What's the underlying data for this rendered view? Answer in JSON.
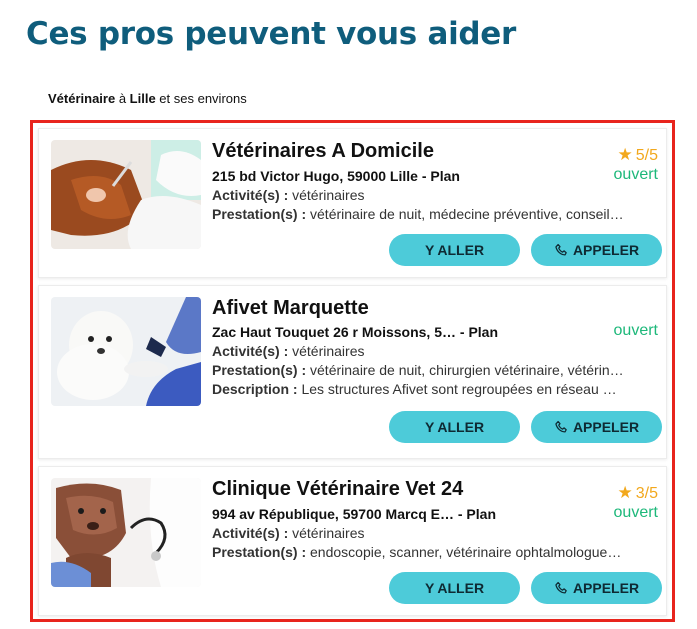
{
  "page": {
    "title": "Ces pros peuvent vous aider",
    "context": {
      "category": "Vétérinaire",
      "sep": " à ",
      "city": "Lille",
      "suffix": " et ses environs"
    }
  },
  "colors": {
    "title": "#0f5d7c",
    "frame": "#e8241d",
    "button": "#4dcbd9",
    "open": "#1db87a",
    "star": "#f2a81d"
  },
  "labels": {
    "activity": "Activité(s) :",
    "services": "Prestation(s) :",
    "description": "Description :",
    "goto_button": "Y ALLER",
    "call_button": "APPELER"
  },
  "results": [
    {
      "name": "Vétérinaires A Domicile",
      "address": "215 bd Victor Hugo, 59000 Lille - Plan",
      "rating": "5/5",
      "status": "ouvert",
      "activity": "vétérinaires",
      "services": "vétérinaire de nuit, médecine préventive, conseil…",
      "image_icon": "dog-ear-exam-photo"
    },
    {
      "name": "Afivet Marquette",
      "address": "Zac Haut Touquet 26 r Moissons, 5…   - Plan",
      "status": "ouvert",
      "activity": "vétérinaires",
      "services": "vétérinaire de nuit, chirurgien vétérinaire, vétérin…",
      "description": "Les structures Afivet sont regroupées en réseau …",
      "image_icon": "white-dog-paw-bandage-photo"
    },
    {
      "name": "Clinique Vétérinaire Vet 24",
      "address": "994 av République, 59700 Marcq E…   - Plan",
      "rating": "3/5",
      "status": "ouvert",
      "activity": "vétérinaires",
      "services": "endoscopie, scanner, vétérinaire ophtalmologue…",
      "image_icon": "shar-pei-puppy-stethoscope-photo"
    }
  ]
}
